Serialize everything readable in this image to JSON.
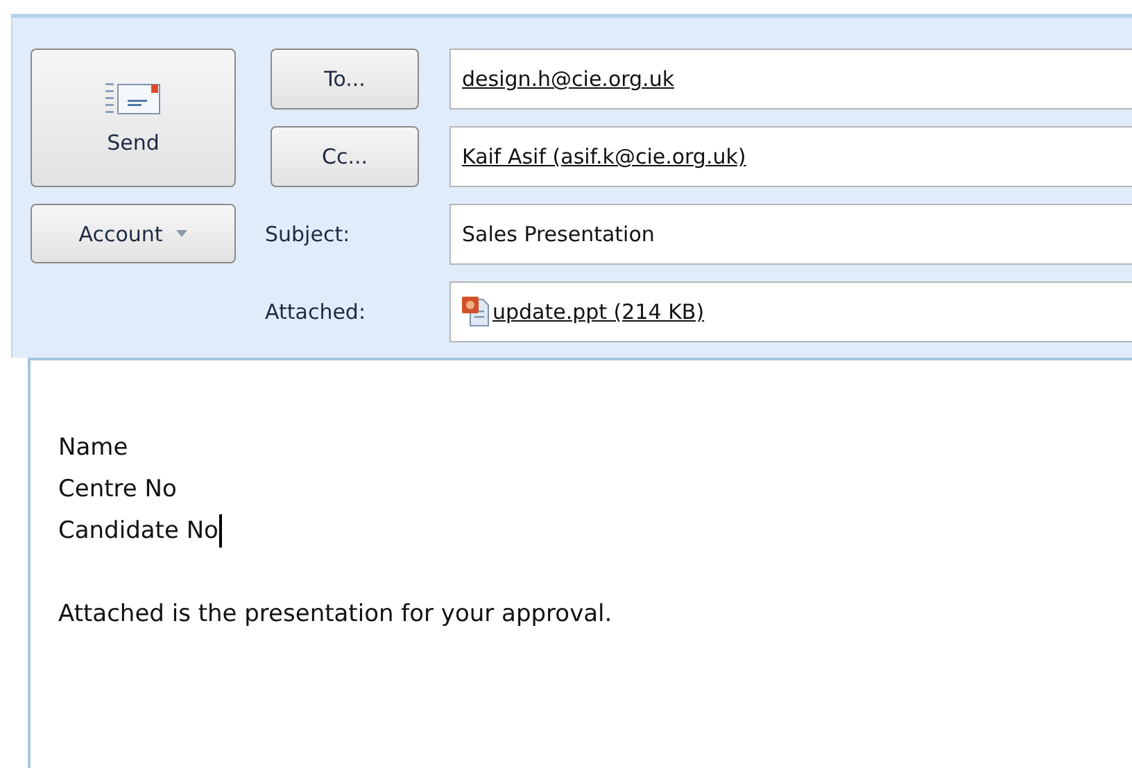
{
  "send_button": {
    "label": "Send"
  },
  "account_button": {
    "label": "Account"
  },
  "recipients": [
    {
      "button": "To...",
      "value": "design.h@cie.org.uk"
    },
    {
      "button": "Cc...",
      "value": "Kaif Asif (asif.k@cie.org.uk)"
    }
  ],
  "subject": {
    "label": "Subject:",
    "value": "Sales Presentation"
  },
  "attached": {
    "label": "Attached:",
    "file": "update.ppt (214 KB)"
  },
  "body": {
    "lines": [
      "Name",
      "Centre No",
      "Candidate No"
    ],
    "paragraph": "Attached is the presentation for your approval."
  }
}
